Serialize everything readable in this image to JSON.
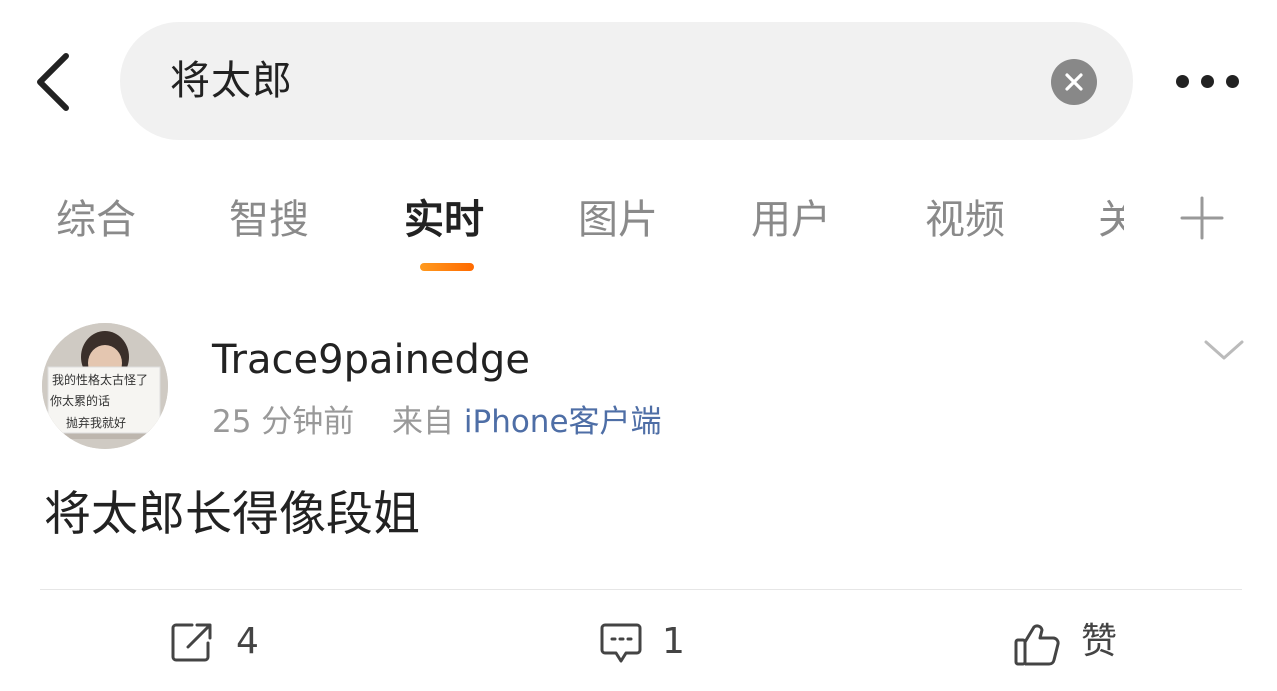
{
  "search": {
    "value": "将太郎"
  },
  "tabs": [
    {
      "label": "综合"
    },
    {
      "label": "智搜"
    },
    {
      "label": "实时"
    },
    {
      "label": "图片"
    },
    {
      "label": "用户"
    },
    {
      "label": "视频"
    },
    {
      "label": "关"
    }
  ],
  "post": {
    "username": "Trace9painedge",
    "time": "25 分钟前",
    "from_prefix": "来自",
    "source": "iPhone客户端",
    "avatar_sign": [
      "我的性格太古怪了",
      "你太累的话",
      "抛弃我就好"
    ],
    "text": "将太郎长得像段姐"
  },
  "actions": {
    "repost_count": "4",
    "comment_count": "1",
    "like_label": "赞"
  },
  "colors": {
    "accent": "#ff7a00",
    "link": "#4e6ea6"
  }
}
